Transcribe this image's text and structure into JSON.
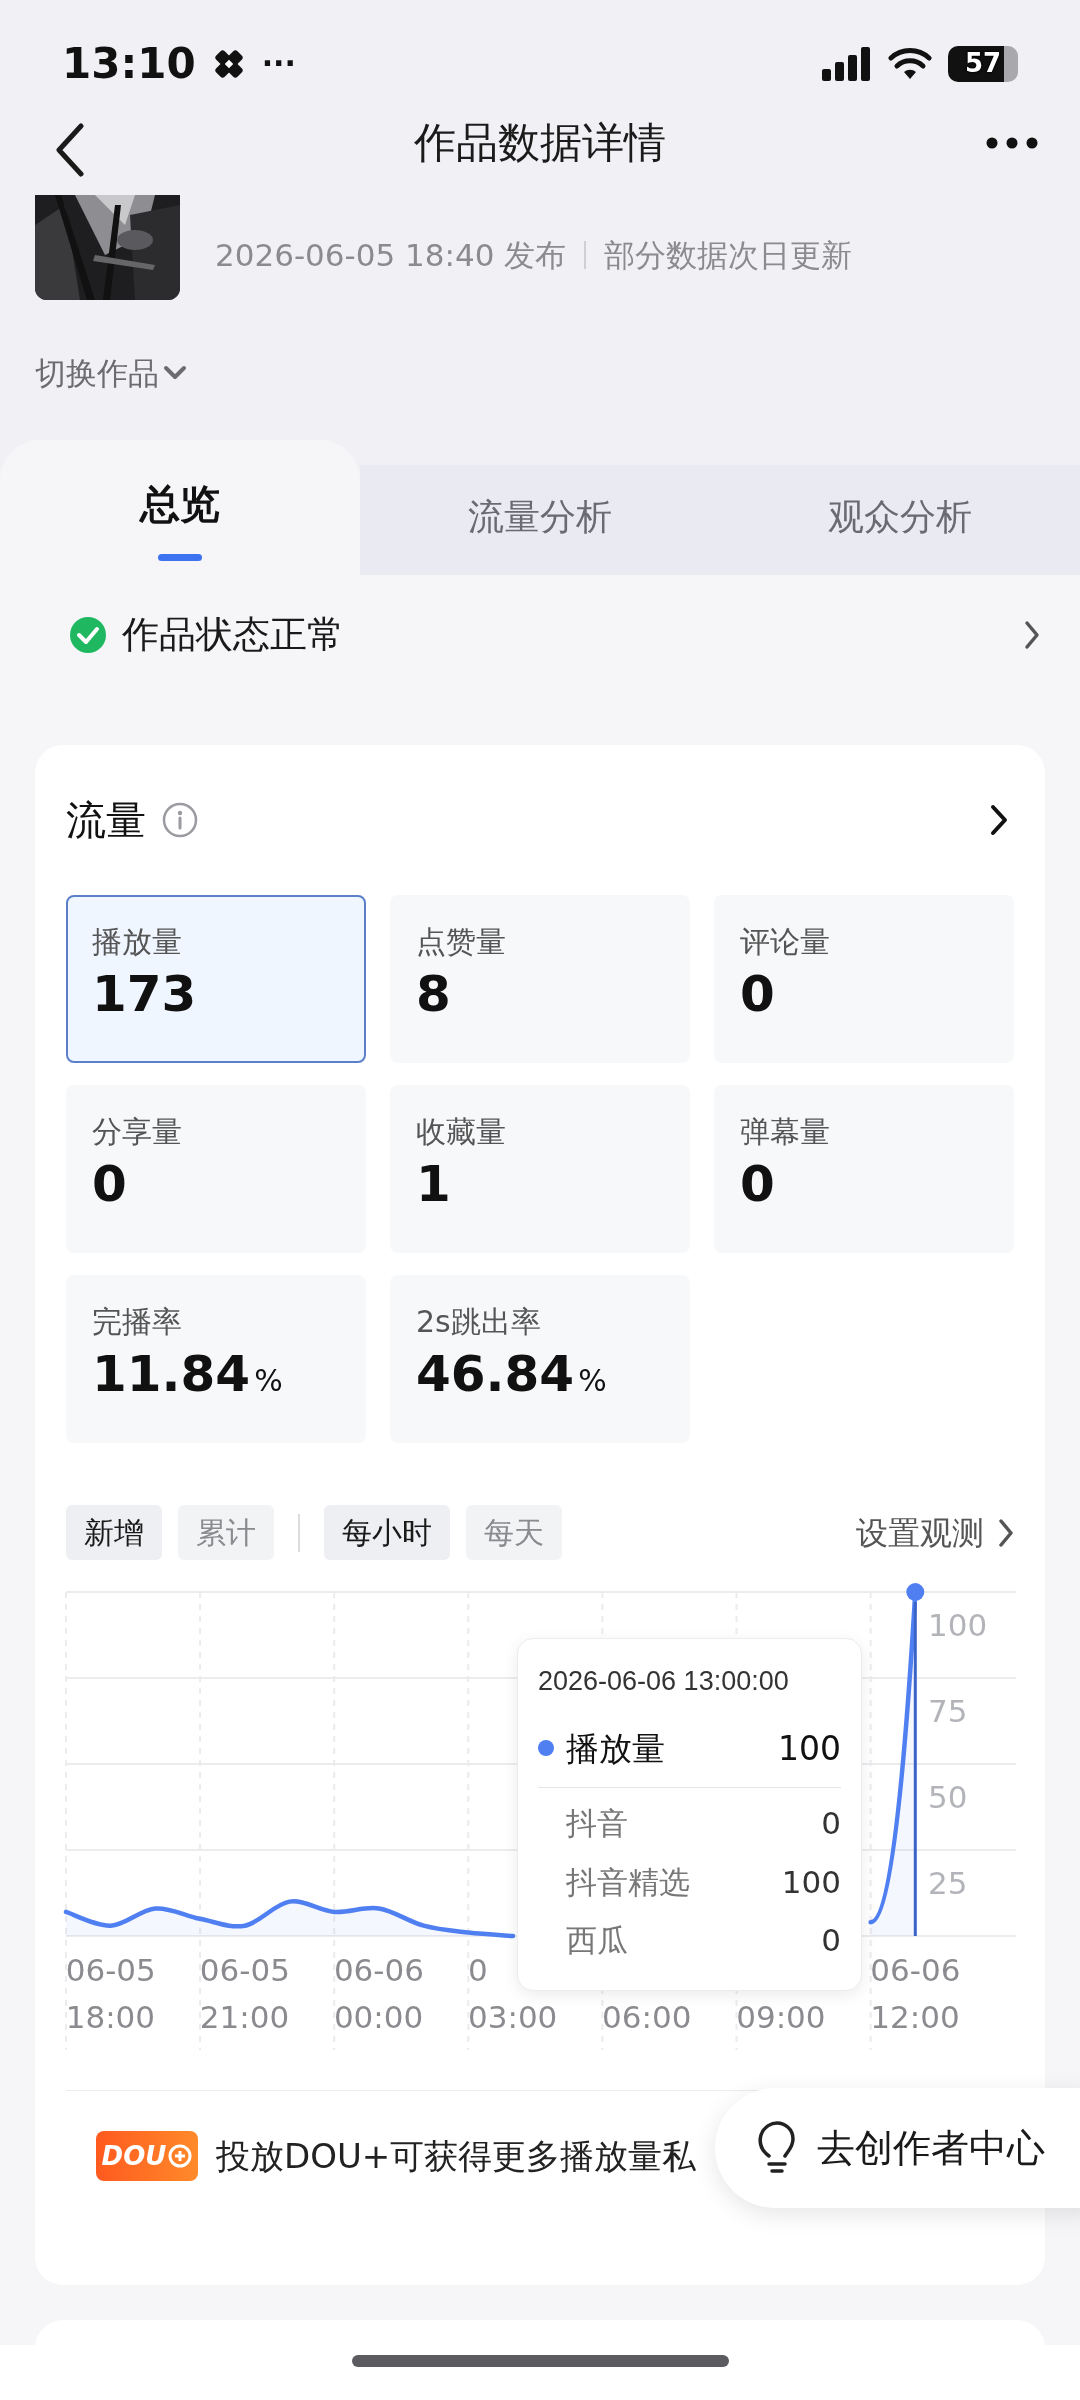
{
  "status_bar": {
    "time": "13:10",
    "more": "···",
    "battery": "57"
  },
  "header": {
    "title": "作品数据详情"
  },
  "video": {
    "published": "2026-06-05 18:40 发布",
    "note": "部分数据次日更新"
  },
  "switch_work": "切换作品",
  "tabs": [
    {
      "label": "总览",
      "selected": true
    },
    {
      "label": "流量分析",
      "selected": false
    },
    {
      "label": "观众分析",
      "selected": false
    }
  ],
  "work_status": {
    "text": "作品状态正常",
    "ok": true
  },
  "traffic_card": {
    "title": "流量",
    "metrics": [
      {
        "label": "播放量",
        "value": "173",
        "selected": true
      },
      {
        "label": "点赞量",
        "value": "8",
        "selected": false
      },
      {
        "label": "评论量",
        "value": "0",
        "selected": false
      },
      {
        "label": "分享量",
        "value": "0",
        "selected": false
      },
      {
        "label": "收藏量",
        "value": "1",
        "selected": false
      },
      {
        "label": "弹幕量",
        "value": "0",
        "selected": false
      },
      {
        "label": "完播率",
        "value": "11.84",
        "unit": "%",
        "selected": false
      },
      {
        "label": "2s跳出率",
        "value": "46.84",
        "unit": "%",
        "selected": false
      }
    ],
    "mode_filters": [
      {
        "label": "新增",
        "selected": true
      },
      {
        "label": "累计",
        "selected": false
      }
    ],
    "interval_filters": [
      {
        "label": "每小时",
        "selected": true
      },
      {
        "label": "每天",
        "selected": false
      }
    ],
    "observe_link": "设置观测",
    "chart": {
      "chart_data": {
        "type": "area",
        "grid": true,
        "categories": [
          null,
          "06-05 18:00",
          null,
          null,
          "06-05 21:00",
          null,
          null,
          "06-06 00:00",
          null,
          null,
          "0 03:00",
          null,
          null,
          "06:00",
          null,
          null,
          "09:00",
          null,
          null,
          "06-06 12:00"
        ],
        "ylim": [
          0,
          100
        ],
        "yticks": [
          25,
          50,
          75,
          100
        ],
        "series": [
          {
            "name": "播放量",
            "color": "#4f7ff0",
            "values": [
              7,
              3,
              8,
              5,
              3,
              10,
              7,
              8,
              3,
              1,
              0,
              null,
              null,
              null,
              null,
              null,
              null,
              null,
              4,
              100
            ]
          }
        ]
      },
      "tooltip": {
        "time": "2026-06-06 13:00:00",
        "main": {
          "value": "100"
        },
        "rows": [
          {
            "label": "抖音",
            "value": "0"
          },
          {
            "label": "抖音精选",
            "value": "100"
          },
          {
            "label": "西瓜",
            "value": "0"
          }
        ]
      }
    },
    "promo": {
      "badge": "DOU",
      "text": "投放DOU+可获得更多播放量私"
    }
  },
  "floating_button": {
    "label": "去创作者中心"
  }
}
